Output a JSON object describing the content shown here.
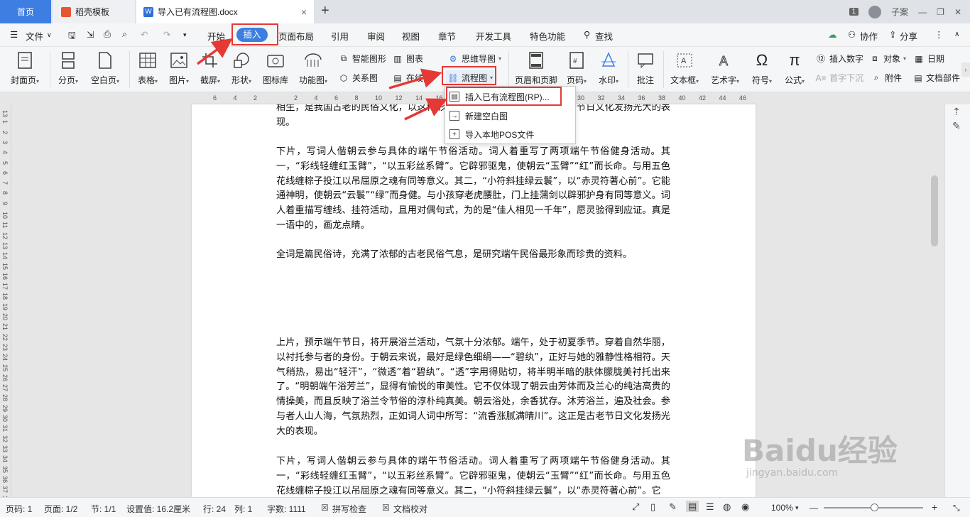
{
  "tabs": {
    "home": "首页",
    "template": "稻壳模板",
    "document": "导入已有流程图.docx",
    "close": "×",
    "new": "+"
  },
  "window": {
    "badge": "1",
    "user": "子案",
    "minimize": "—",
    "restore": "❐",
    "close": "✕"
  },
  "menu": {
    "file": "文件",
    "items": [
      "开始",
      "插入",
      "页面布局",
      "引用",
      "审阅",
      "视图",
      "章节",
      "开发工具",
      "特色功能",
      "查找"
    ],
    "right": [
      "协作",
      "分享"
    ]
  },
  "ribbon": {
    "cover": "封面页",
    "pagebreak": "分页",
    "blank": "空白页",
    "table": "表格",
    "picture": "图片",
    "screenshot": "截屏",
    "shape": "形状",
    "iconlib": "图标库",
    "funcchart": "功能图",
    "smartart": "智能图形",
    "chart": "图表",
    "relation": "关系图",
    "online": "在线图",
    "mindmap": "思维导图",
    "flowchart": "流程图",
    "headerfooter": "页眉和页脚",
    "pagenum": "页码",
    "watermark": "水印",
    "comment": "批注",
    "textbox": "文本框",
    "arttext": "艺术字",
    "symbol": "符号",
    "formula": "公式",
    "insertnum": "插入数字",
    "object": "对象",
    "date": "日期",
    "dropcap": "首字下沉",
    "attach": "附件",
    "docpart": "文档部件"
  },
  "dropdown": {
    "items": [
      "插入已有流程图(RP)...",
      "新建空白图",
      "导入本地POS文件"
    ]
  },
  "ruler": {
    "top": [
      "6",
      "4",
      "2",
      "",
      "2",
      "4",
      "6",
      "8",
      "10",
      "12",
      "14",
      "16",
      "18",
      "20",
      "22",
      "24",
      "26",
      "28",
      "30",
      "32",
      "34",
      "36",
      "38",
      "40",
      "42",
      "44",
      "46"
    ],
    "left": [
      "13",
      "1",
      "2",
      "3",
      "4",
      "5",
      "6",
      "7",
      "8",
      "9",
      "10",
      "11",
      "12",
      "13",
      "14",
      "15",
      "16",
      "17",
      "18",
      "19",
      "20",
      "21",
      "22",
      "23",
      "24",
      "25",
      "26",
      "27",
      "28",
      "29",
      "30",
      "31",
      "32",
      "33",
      "34",
      "35",
      "36",
      "37",
      "38"
    ]
  },
  "document": {
    "p0": "相生，是我国古老的民俗文化，以这种形式得以保存和发扬，这正是古老节日文化发扬光大的表现。",
    "p1": "下片，写词人偕朝云参与具体的端午节俗活动。词人着重写了两项端午节俗健身活动。其一，“彩线轻缠红玉臂”，“以五彩丝系臂”。它辟邪驱鬼，使朝云“玉臂”“红”而长命。与用五色花线缠粽子投江以吊屈原之魂有同等意义。其二，“小符斜挂绿云鬟”，以“赤灵符著心前”。它能通神明，使朝云“云鬟”“绿”而身健。与小孩穿老虎腰肚，门上挂蒲剑以辟邪护身有同等意义。词人着重描写缠线、挂符活动，且用对偶句式，为的是“佳人相见一千年”，愿灵验得到应证。真是一语中的，画龙点睛。",
    "p2": "全词是篇民俗诗，充满了浓郁的古老民俗气息，是研究端午民俗最形象而珍贵的资料。",
    "p3": "上片，预示端午节日，将开展浴兰活动，气氛十分浓郁。端午，处于初夏季节。穿着自然华丽，以衬托参与者的身份。于朝云来说，最好是绿色细绢——“碧纨”，正好与她的雅静性格相符。天气稍热，易出“轻汗”，“微透”着“碧纨”。“透”字用得贴切，将半明半暗的肤体朦胧美衬托出来了。“明朝端午浴芳兰”，显得有愉悦的审美性。它不仅体现了朝云由芳体而及兰心的纯洁高贵的情操美，而且反映了浴兰令节俗的淳朴纯真美。朝云浴处，余香犹存。沐芳浴兰，遍及社会。参与者人山人海，气氛热烈，正如词人词中所写：“流香涨腻满晴川”。这正是古老节日文化发扬光大的表现。",
    "p4": "下片，写词人偕朝云参与具体的端午节俗活动。词人着重写了两项端午节俗健身活动。其一，“彩线轻缠红玉臂”，“以五彩丝系臂”。它辟邪驱鬼，使朝云“玉臂”“红”而长命。与用五色花线缠粽子投江以吊屈原之魂有同等意义。其二，“小符斜挂绿云鬟”，以“赤灵符著心前”。它"
  },
  "status": {
    "page": "页码: 1",
    "pages": "页面: 1/2",
    "section": "节: 1/1",
    "setting": "设置值: 16.2厘米",
    "row": "行: 24",
    "col": "列: 1",
    "words": "字数: 1111",
    "spell": "拼写检查",
    "proof": "文档校对",
    "zoom": "100%",
    "minus": "—",
    "plus": "+"
  },
  "watermark": {
    "brand": "Baidu经验",
    "url": "jingyan.baidu.com"
  },
  "colors": {
    "accent": "#3c7fe0",
    "highlight": "#e53935",
    "tabActive": "#3d7ee3"
  }
}
